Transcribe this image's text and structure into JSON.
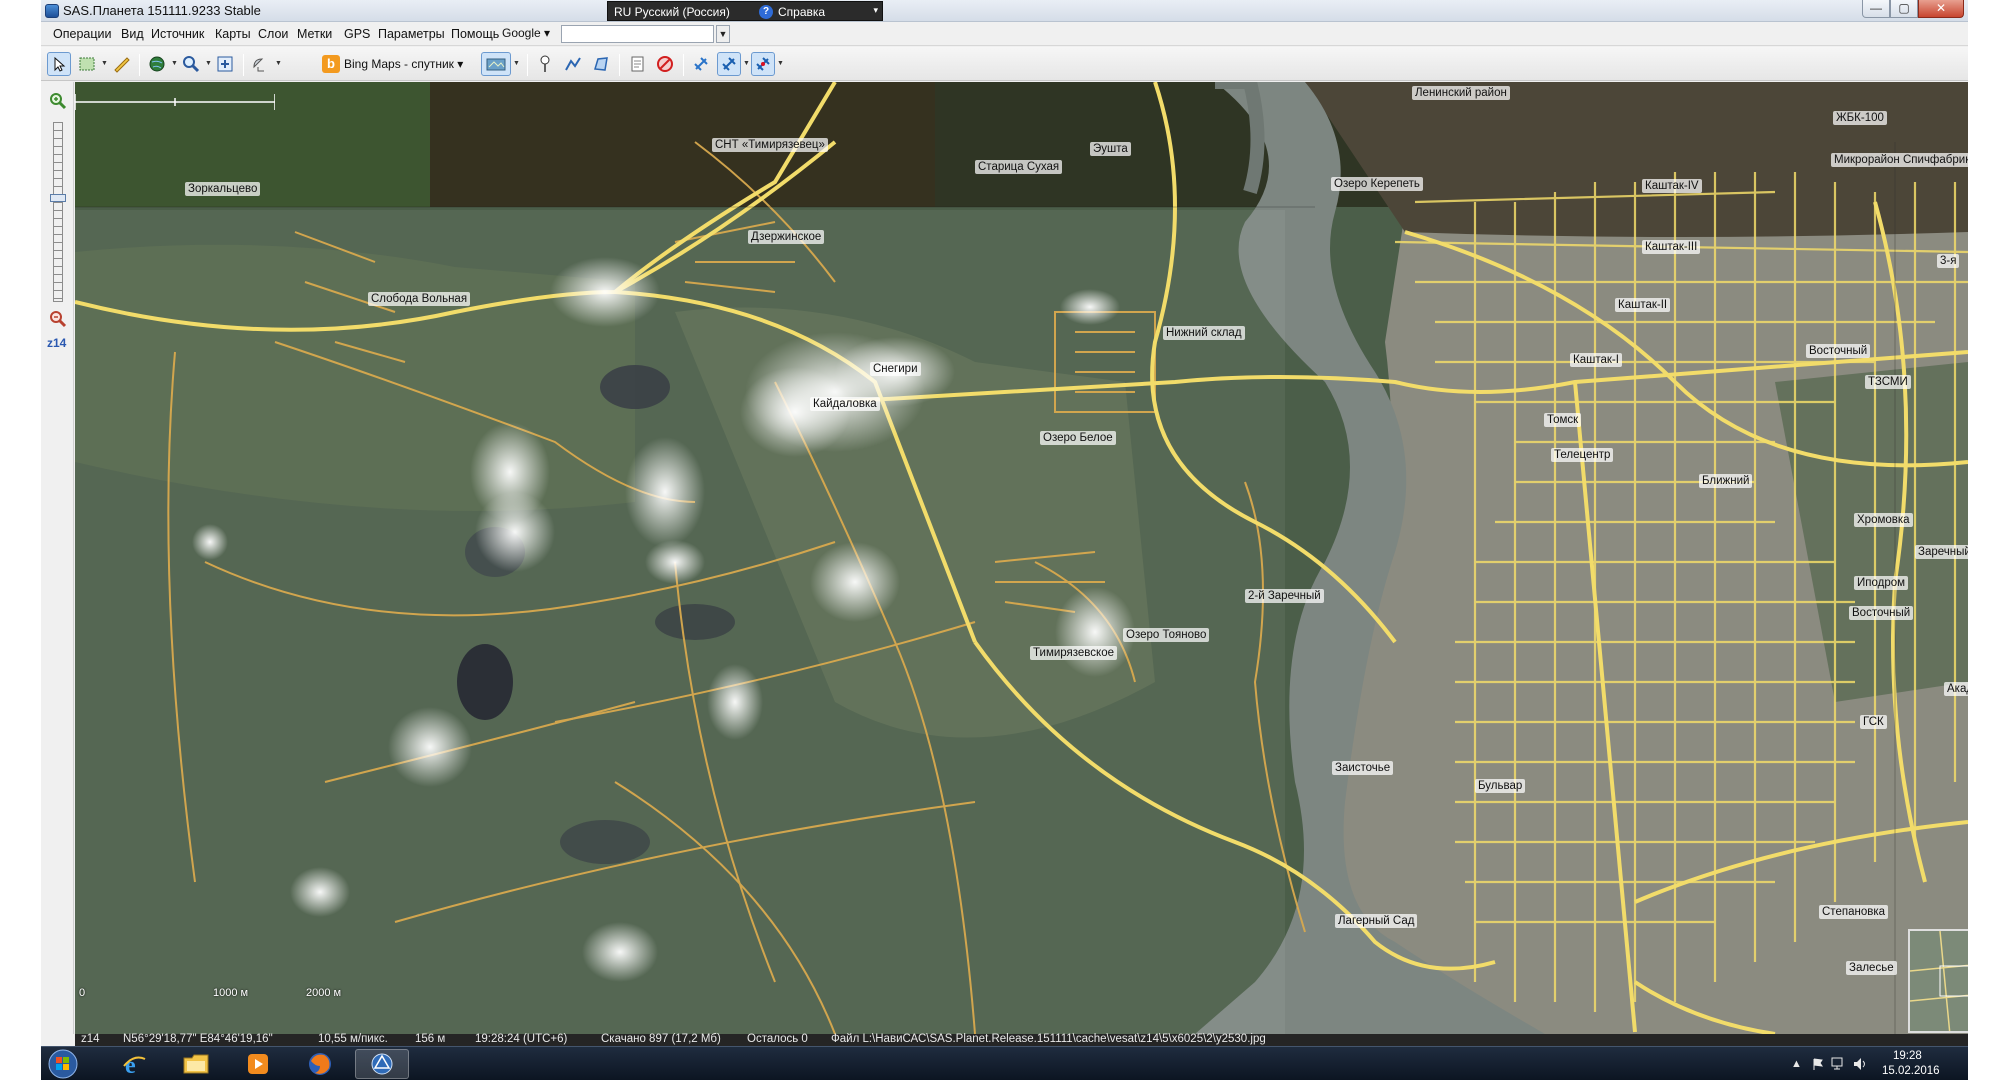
{
  "window": {
    "title": "SAS.Планета 151111.9233 Stable",
    "language": "RU Русский (Россия)",
    "help_label": "Справка",
    "help_icon": "?",
    "minimize": "—",
    "maximize": "▢",
    "close": "✕"
  },
  "menu": {
    "items": [
      "Операции",
      "Вид",
      "Источник",
      "Карты",
      "Слои",
      "Метки",
      "GPS",
      "Параметры",
      "Помощь"
    ],
    "search_provider": "Google ▾",
    "search_value": "",
    "search_go": "▼"
  },
  "toolbar": {
    "map_source": "Bing Maps - спутник ▾",
    "bing_letter": "b"
  },
  "zoom_panel": {
    "zoom_level": "z14"
  },
  "map": {
    "places": [
      "Ленинский район",
      "ЖБК-100",
      "Микрорайон Спичфабрика",
      "СНТ «Тимирязевец»",
      "Эушта",
      "Старица Сухая",
      "Зоркальцево",
      "Озеро Керепеть",
      "Каштак-IV",
      "Дзержинское",
      "Каштак-III",
      "3-я",
      "Слобода Вольная",
      "Каштак-II",
      "Нижний склад",
      "Каштак-I",
      "Восточный",
      "Снегири",
      "ТЗСМИ",
      "Кайдаловка",
      "Томск",
      "Озеро Белое",
      "Телецентр",
      "Ближний",
      "Хромовка",
      "Заречный",
      "Иподром",
      "2-й Заречный",
      "Восточный",
      "Озеро Тояново",
      "Тимирязевское",
      "Академ",
      "ГСК",
      "Заисточье",
      "Бульвар",
      "Степановка",
      "Лагерный Сад",
      "Залесье"
    ],
    "scale": {
      "zero": "0",
      "mid": "1000 м",
      "end": "2000 м"
    }
  },
  "status": {
    "zoom": "z14",
    "coords": "N56°29'18,77\" E84°46'19,16\"",
    "resolution": "10,55 м/пикс.",
    "elevation": "156 м",
    "time": "19:28:24 (UTC+6)",
    "downloaded": "Скачано 897 (17,2 Мб)",
    "remaining": "Осталось 0",
    "file": "Файл L:\\НавиСАС\\SAS.Planet.Release.151111\\cache\\vesat\\z14\\5\\x6025\\2\\y2530.jpg"
  },
  "taskbar": {
    "time": "19:28",
    "date": "15.02.2016",
    "tray_arrow": "▲"
  },
  "colors": {
    "road_major": "#f2dc6a",
    "road_minor": "#d8a94e",
    "river": "#7c8580",
    "forest": "#495b46",
    "city": "#8a8a80"
  }
}
